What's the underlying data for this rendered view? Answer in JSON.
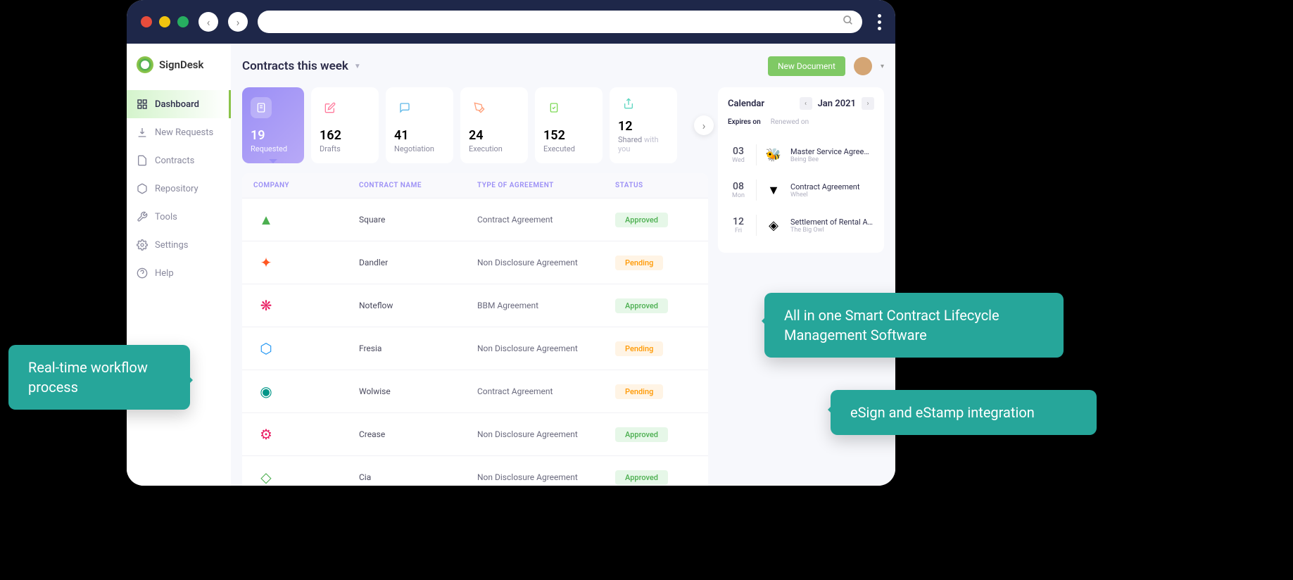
{
  "logo": "SignDesk",
  "sidebar": [
    {
      "label": "Dashboard",
      "icon": "grid"
    },
    {
      "label": "New Requests",
      "icon": "download"
    },
    {
      "label": "Contracts",
      "icon": "document"
    },
    {
      "label": "Repository",
      "icon": "box"
    },
    {
      "label": "Tools",
      "icon": "wrench"
    },
    {
      "label": "Settings",
      "icon": "gear"
    },
    {
      "label": "Help",
      "icon": "question"
    }
  ],
  "header": {
    "title": "Contracts this week",
    "new_doc": "New Document"
  },
  "stats": [
    {
      "value": "19",
      "label": "Requested",
      "icon": "doc",
      "icon_color": "#fff"
    },
    {
      "value": "162",
      "label": "Drafts",
      "icon": "edit",
      "icon_color": "#ff7b9c"
    },
    {
      "value": "41",
      "label": "Negotiation",
      "icon": "chat",
      "icon_color": "#5eb8e8"
    },
    {
      "value": "24",
      "label": "Execution",
      "icon": "pen",
      "icon_color": "#ffa07a"
    },
    {
      "value": "152",
      "label": "Executed",
      "icon": "check",
      "icon_color": "#7ed957"
    },
    {
      "value": "12",
      "label": "Shared",
      "label_suffix": " with you",
      "icon": "share",
      "icon_color": "#5ed6c1"
    }
  ],
  "table": {
    "headers": {
      "company": "COMPANY",
      "name": "CONTRACT NAME",
      "type": "TYPE OF AGREEMENT",
      "status": "STATUS"
    },
    "rows": [
      {
        "name": "Square",
        "type": "Contract Agreement",
        "status": "Approved",
        "logo_glyph": "▲",
        "logo_color": "#4caf50"
      },
      {
        "name": "Dandler",
        "type": "Non Disclosure Agreement",
        "status": "Pending",
        "logo_glyph": "✦",
        "logo_color": "#ff5722"
      },
      {
        "name": "Noteflow",
        "type": "BBM Agreement",
        "status": "Approved",
        "logo_glyph": "❋",
        "logo_color": "#e91e63"
      },
      {
        "name": "Fresia",
        "type": "Non Disclosure Agreement",
        "status": "Pending",
        "logo_glyph": "⬡",
        "logo_color": "#2196f3"
      },
      {
        "name": "Wolwise",
        "type": "Contract Agreement",
        "status": "Pending",
        "logo_glyph": "◉",
        "logo_color": "#009688"
      },
      {
        "name": "Crease",
        "type": "Non Disclosure Agreement",
        "status": "Approved",
        "logo_glyph": "⚙",
        "logo_color": "#e91e63"
      },
      {
        "name": "Cia",
        "type": "Non Disclosure Agreement",
        "status": "Approved",
        "logo_glyph": "◇",
        "logo_color": "#4caf50"
      }
    ]
  },
  "calendar": {
    "title": "Calendar",
    "month": "Jan 2021",
    "tabs": {
      "expires": "Expires on",
      "renewed": "Renewed on"
    },
    "items": [
      {
        "day": "03",
        "weekday": "Wed",
        "contract": "Master Service Agreement",
        "company": "Being Bee",
        "glyph": "🐝"
      },
      {
        "day": "08",
        "weekday": "Mon",
        "contract": "Contract Agreement",
        "company": "Wheel",
        "glyph": "▼"
      },
      {
        "day": "12",
        "weekday": "Fri",
        "contract": "Settlement of Rental Ag...",
        "company": "The Big Owl",
        "glyph": "◈"
      }
    ]
  },
  "callouts": {
    "left": "Real-time workflow process",
    "right1": "All in one Smart Contract Lifecycle Management Software",
    "right2": "eSign and eStamp integration"
  }
}
